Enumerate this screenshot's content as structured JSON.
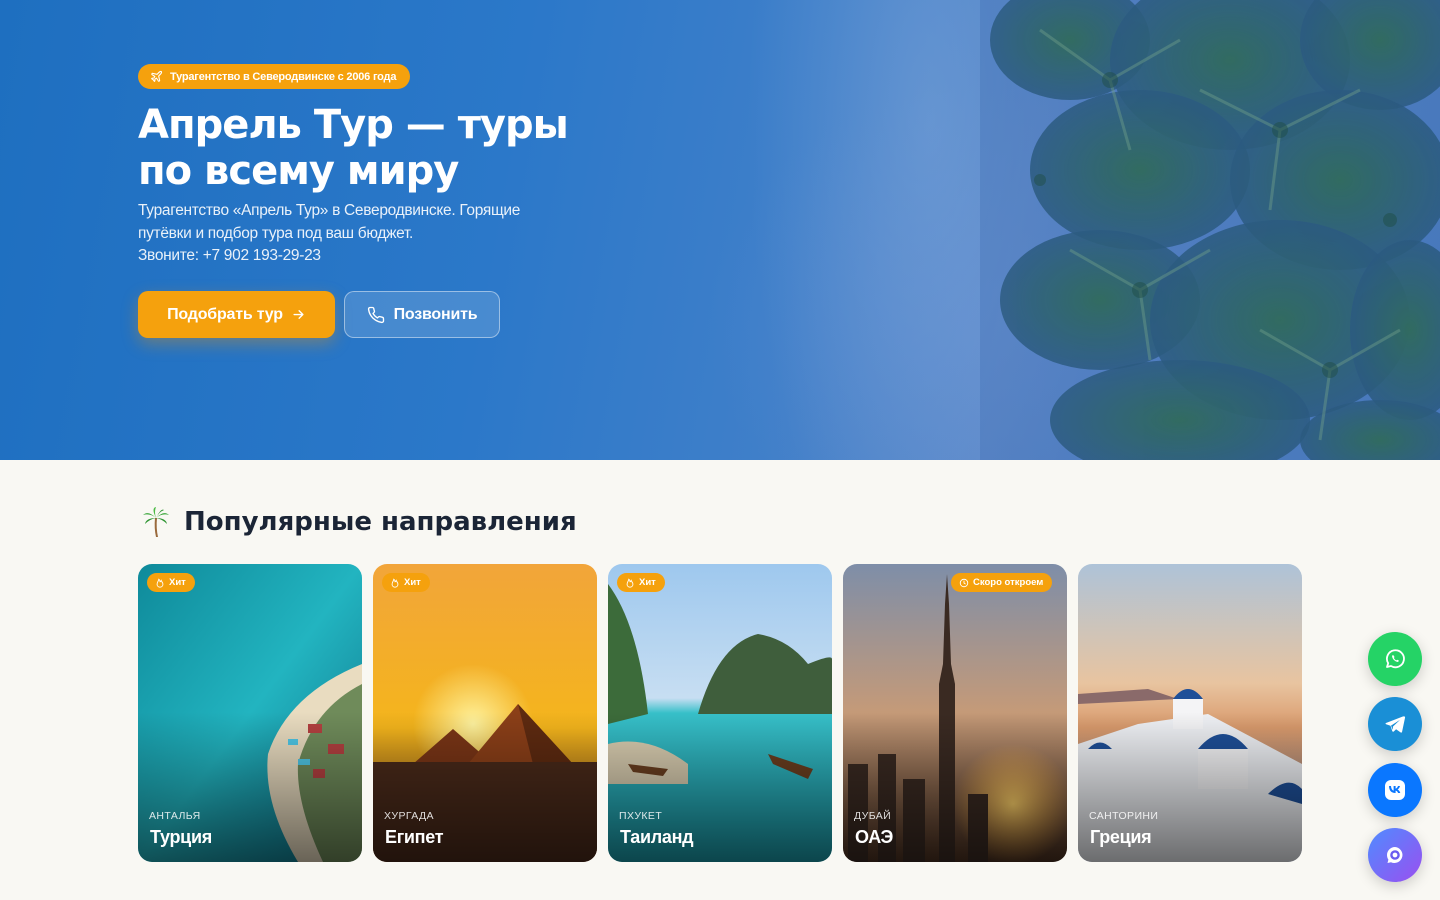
{
  "hero": {
    "badge": "Турагентство в Северодвинске с 2006 года",
    "title_line1": "Апрель Тур — туры",
    "title_line2": "по всему миру",
    "subtitle_line1": "Турагентство «Апрель Тур» в Северодвинске. Горящие",
    "subtitle_line2": "путёвки и подбор тура под ваш бюджет.",
    "phone_line": "Звоните: +7 902 193-29-23",
    "primary_button": "Подобрать тур",
    "secondary_button": "Позвонить"
  },
  "destinations": {
    "title": "Популярные направления",
    "cards": [
      {
        "city": "Анталья",
        "country": "Турция",
        "tag": "Хит",
        "tag_icon": "flame-icon"
      },
      {
        "city": "Хургада",
        "country": "Египет",
        "tag": "Хит",
        "tag_icon": "flame-icon"
      },
      {
        "city": "Пхукет",
        "country": "Таиланд",
        "tag": "Хит",
        "tag_icon": "flame-icon"
      },
      {
        "city": "Дубай",
        "country": "ОАЭ",
        "tag": "Скоро откроем",
        "tag_icon": "clock-icon"
      },
      {
        "city": "Санторини",
        "country": "Греция",
        "tag": "",
        "tag_icon": ""
      }
    ]
  },
  "floating_buttons": [
    {
      "icon": "whatsapp-icon",
      "color": "#25d366"
    },
    {
      "icon": "telegram-icon",
      "color": "#1a8fd6"
    },
    {
      "icon": "vk-icon",
      "color": "#0a77ff"
    },
    {
      "icon": "max-messenger-icon",
      "color": "#7a5cf0"
    }
  ],
  "colors": {
    "accent": "#f5a10d",
    "hero_blue": "#2371c4",
    "heading": "#1b2536",
    "page_bg": "#f9f8f3"
  }
}
